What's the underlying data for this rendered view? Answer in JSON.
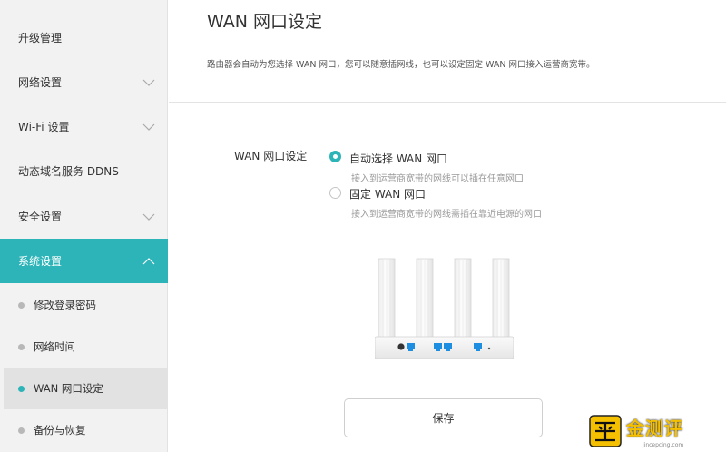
{
  "sidebar": {
    "items": [
      {
        "label": "升级管理",
        "has_chevron": false
      },
      {
        "label": "网络设置",
        "has_chevron": true
      },
      {
        "label": "Wi-Fi 设置",
        "has_chevron": true
      },
      {
        "label": "动态域名服务 DDNS",
        "has_chevron": false
      },
      {
        "label": "安全设置",
        "has_chevron": true
      },
      {
        "label": "系统设置",
        "has_chevron": true,
        "active": true
      }
    ],
    "sub_items": [
      {
        "label": "修改登录密码"
      },
      {
        "label": "网络时间"
      },
      {
        "label": "WAN 网口设定",
        "selected": true
      },
      {
        "label": "备份与恢复"
      }
    ]
  },
  "main": {
    "title": "WAN 网口设定",
    "description": "路由器会自动为您选择 WAN 网口，您可以随意插网线，也可以设定固定 WAN 网口接入运营商宽带。",
    "field_label": "WAN 网口设定",
    "options": [
      {
        "label": "自动选择 WAN 网口",
        "desc": "接入到运营商宽带的网线可以插在任意网口",
        "checked": true
      },
      {
        "label": "固定 WAN 网口",
        "desc": "接入到运营商宽带的网线需插在靠近电源的网口",
        "checked": false
      }
    ],
    "router_icon": "router-back-panel-illustration",
    "save_label": "保存"
  },
  "watermark": {
    "text": "金测评",
    "url": "jincepcing.com"
  },
  "colors": {
    "accent": "#2cb4b8",
    "sidebar_bg": "#f2f2f2",
    "port_blue": "#1e8fe0",
    "watermark_gold": "#f5c000"
  }
}
